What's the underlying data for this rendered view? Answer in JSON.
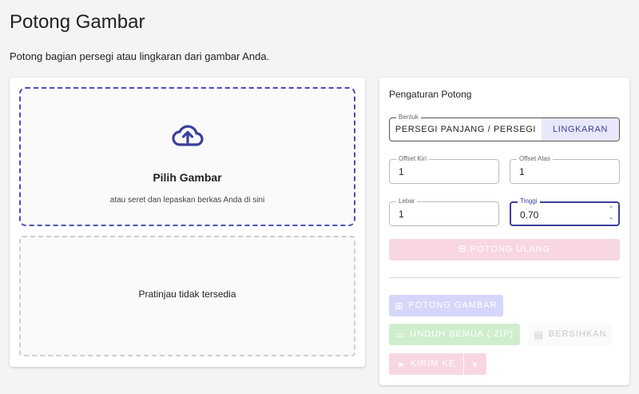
{
  "header": {
    "title": "Potong Gambar",
    "subtitle": "Potong bagian persegi atau lingkaran dari gambar Anda."
  },
  "upload": {
    "title": "Pilih Gambar",
    "hint": "atau seret dan lepaskan berkas Anda di sini",
    "icon": "cloud-upload-icon"
  },
  "preview": {
    "empty_text": "Pratinjau tidak tersedia"
  },
  "settings": {
    "title": "Pengaturan Potong",
    "shape": {
      "legend": "Bentuk",
      "options": [
        "PERSEGI PANJANG / PERSEGI",
        "LINGKARAN"
      ],
      "selected": "LINGKARAN"
    },
    "offset_left": {
      "label": "Offset Kiri",
      "value": "1"
    },
    "offset_top": {
      "label": "Offset Atas",
      "value": "1"
    },
    "width": {
      "label": "Lebar",
      "value": "1"
    },
    "height": {
      "label": "Tinggi",
      "value": "0.70"
    },
    "recrop_label": "POTONG ULANG"
  },
  "actions": {
    "crop_label": "POTONG GAMBAR",
    "download_all_label": "UNDUH SEMUA (.ZIP)",
    "clear_label": "BERSIHKAN",
    "send_to_label": "KIRIM KE"
  },
  "colors": {
    "accent": "#3b3f9c",
    "upload_border": "#4a4fb8",
    "pink_disabled": "#f8d7e1",
    "purple_disabled": "#d6d6fb",
    "green_disabled": "#cfeecd"
  }
}
